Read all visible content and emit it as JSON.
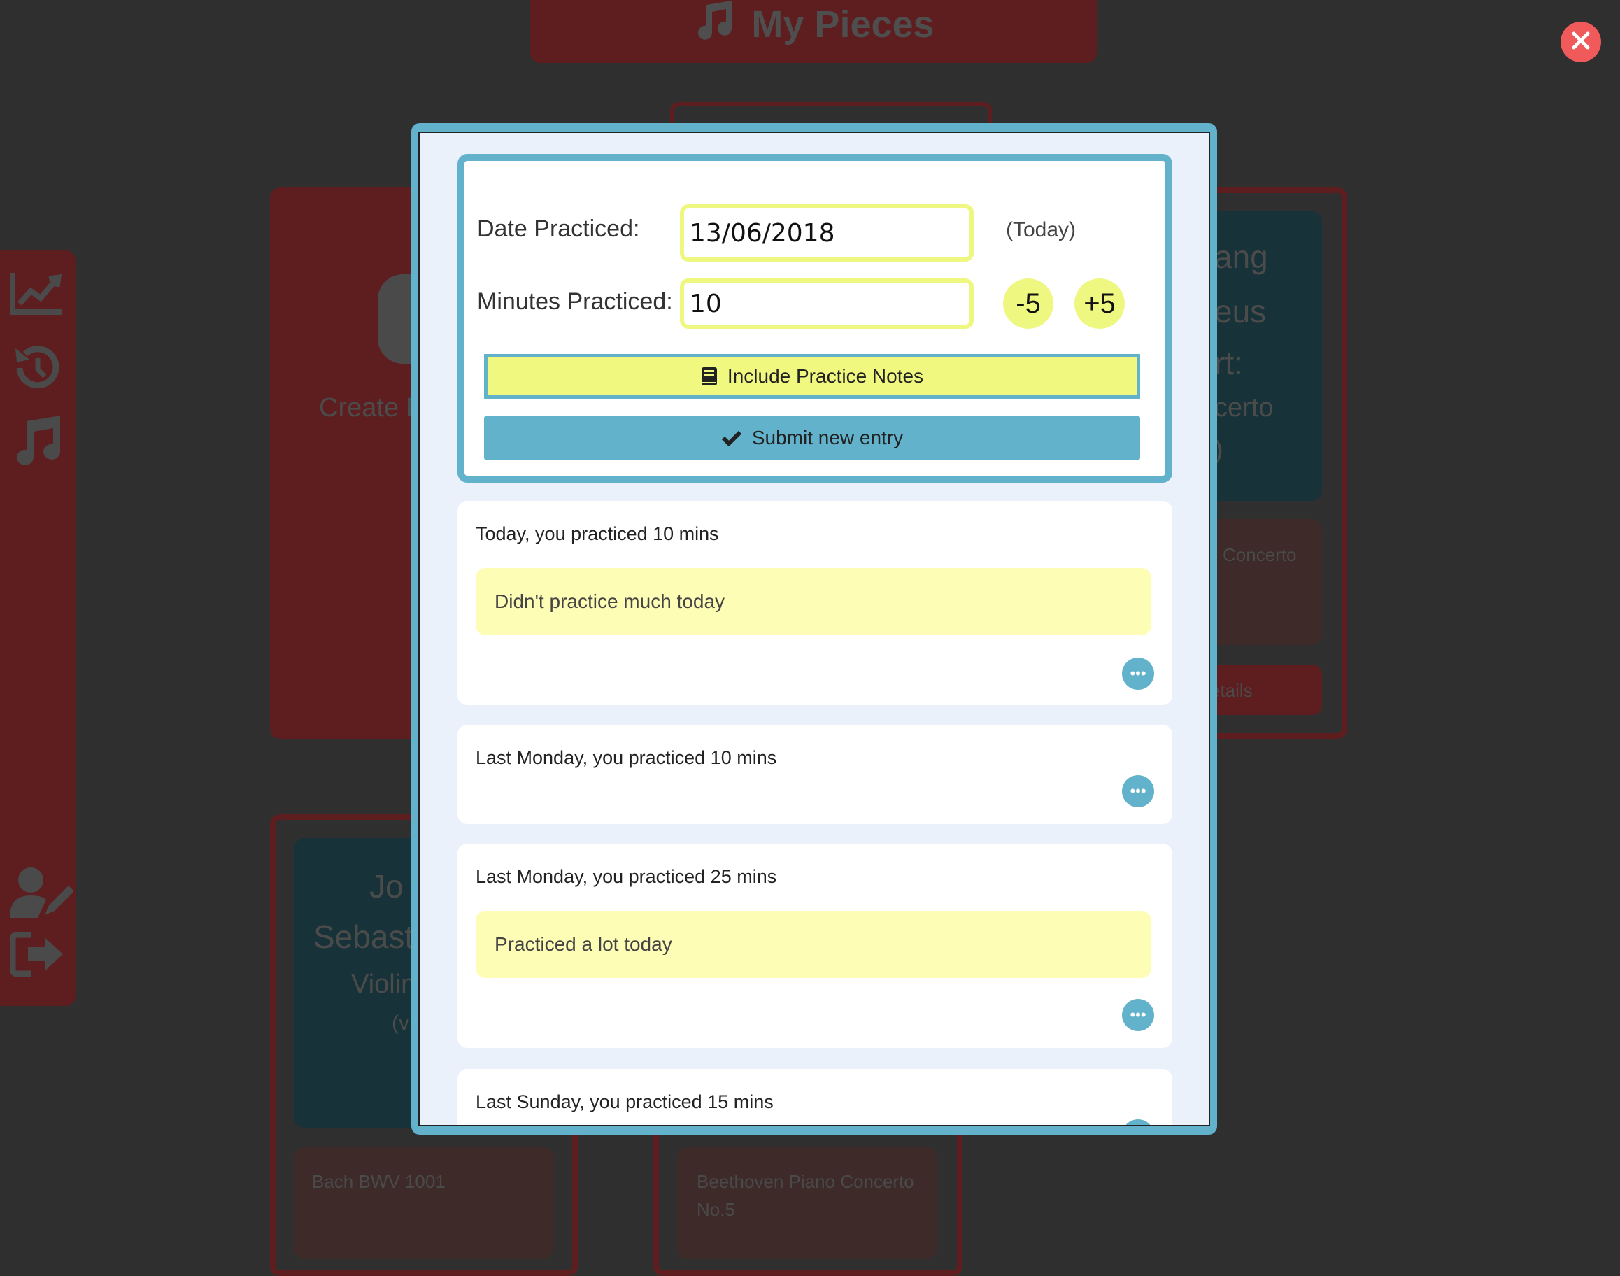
{
  "app": {
    "title": "My Pieces",
    "title_icon": "music-note-icon"
  },
  "sidebar": {
    "items": [
      {
        "icon": "chart-line-icon"
      },
      {
        "icon": "history-icon"
      },
      {
        "icon": "music-note-icon"
      },
      {
        "icon": "user-edit-icon"
      },
      {
        "icon": "sign-out-icon"
      }
    ]
  },
  "background": {
    "create_label": "Create N",
    "piece_right_fragments": [
      "ang",
      "eus",
      "rt:",
      "certo",
      ")"
    ],
    "piece_right_subtitle": "Concerto",
    "piece_right_button": "etails",
    "piece_left_fragments": [
      "Jo",
      "Sebast",
      "Violin",
      "(v"
    ],
    "card_bach": "Bach BWV 1001",
    "card_beethoven_line1": "Beethoven Piano Concerto",
    "card_beethoven_line2": "No.5"
  },
  "form": {
    "date_label": "Date Practiced:",
    "date_value": "13/06/2018",
    "date_hint": "(Today)",
    "minutes_label": "Minutes Practiced:",
    "minutes_value": "10",
    "minus_label": "-5",
    "plus_label": "+5",
    "notes_button_label": "Include Practice Notes",
    "notes_button_icon": "book-icon",
    "submit_button_label": "Submit new entry",
    "submit_button_icon": "check-icon"
  },
  "entries": [
    {
      "title": "Today, you practiced 10 mins",
      "note": "Didn't practice much today"
    },
    {
      "title": "Last Monday, you practiced 10 mins",
      "note": ""
    },
    {
      "title": "Last Monday, you practiced 25 mins",
      "note": "Practiced a lot today"
    },
    {
      "title": "Last Sunday, you practiced 15 mins",
      "note": ""
    }
  ],
  "more_label": "•••",
  "colors": {
    "accent_blue": "#62b2cc",
    "accent_yellow": "#eef77f",
    "note_yellow": "#fefdb6",
    "close_red": "#f05a5a",
    "brand_red_dimmed": "#5e1d1f"
  }
}
